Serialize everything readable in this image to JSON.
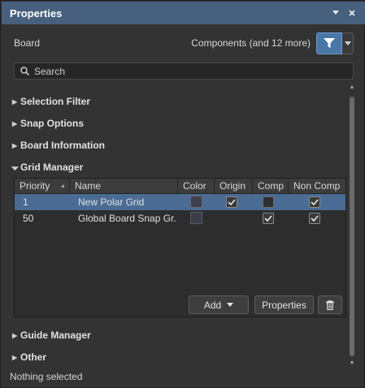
{
  "titlebar": {
    "title": "Properties",
    "menu_icon": "dropdown-arrow-icon",
    "close_icon": "close-icon"
  },
  "header": {
    "object_type": "Board",
    "filter_summary": "Components (and 12 more)",
    "filter_icon": "filter-icon",
    "accent_color": "#4a78a6"
  },
  "search": {
    "placeholder": "Search",
    "value": ""
  },
  "sections": {
    "selection_filter": "Selection Filter",
    "snap_options": "Snap Options",
    "board_information": "Board Information",
    "grid_manager": "Grid Manager",
    "guide_manager": "Guide Manager",
    "other": "Other"
  },
  "grid_manager": {
    "columns": [
      "Priority",
      "Name",
      "Color",
      "Origin",
      "Comp",
      "Non Comp"
    ],
    "rows": [
      {
        "priority": "1",
        "name": "New Polar Grid",
        "origin": true,
        "comp": false,
        "non_comp": true,
        "selected": true
      },
      {
        "priority": "50",
        "name": "Global Board Snap Gr...",
        "origin": false,
        "comp": true,
        "non_comp": true,
        "selected": false
      }
    ],
    "add_label": "Add",
    "properties_label": "Properties",
    "delete_icon": "trash-icon",
    "selection_color": "#4a6c94"
  },
  "status": {
    "text": "Nothing selected"
  }
}
